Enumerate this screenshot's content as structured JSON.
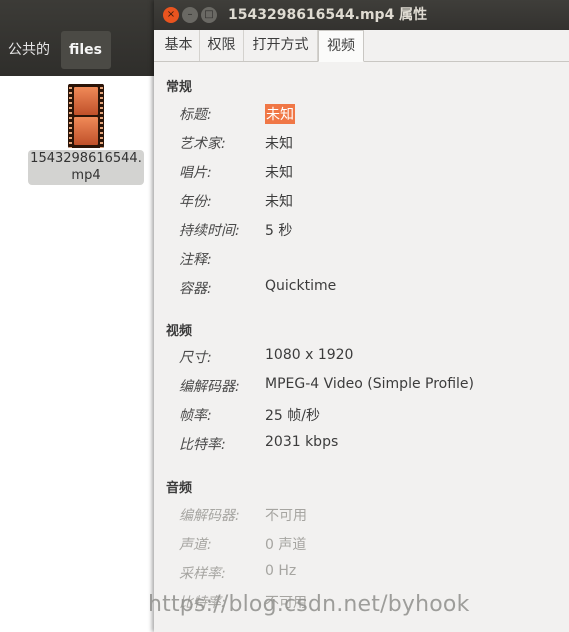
{
  "file_manager": {
    "path_buttons": [
      "公共的",
      "files"
    ],
    "file": {
      "name_line1": "1543298616544.",
      "name_line2": "mp4"
    }
  },
  "dialog": {
    "title": "1543298616544.mp4 属性",
    "window_buttons": {
      "close": "×",
      "minimize": "–",
      "maximize": "□"
    },
    "tabs": [
      "基本",
      "权限",
      "打开方式",
      "视频"
    ],
    "active_tab": "视频",
    "sections": {
      "general": {
        "header": "常规",
        "rows": [
          {
            "label": "标题:",
            "value": "未知"
          },
          {
            "label": "艺术家:",
            "value": "未知"
          },
          {
            "label": "唱片:",
            "value": "未知"
          },
          {
            "label": "年份:",
            "value": "未知"
          },
          {
            "label": "持续时间:",
            "value": "5 秒"
          },
          {
            "label": "注释:",
            "value": ""
          },
          {
            "label": "容器:",
            "value": "Quicktime"
          }
        ]
      },
      "video": {
        "header": "视频",
        "rows": [
          {
            "label": "尺寸:",
            "value": "1080 x 1920"
          },
          {
            "label": "编解码器:",
            "value": "MPEG-4 Video (Simple Profile)"
          },
          {
            "label": "帧率:",
            "value": "25 帧/秒"
          },
          {
            "label": "比特率:",
            "value": "2031 kbps"
          }
        ]
      },
      "audio": {
        "header": "音频",
        "rows": [
          {
            "label": "编解码器:",
            "value": "不可用"
          },
          {
            "label": "声道:",
            "value": "0 声道"
          },
          {
            "label": "采样率:",
            "value": "0 Hz"
          },
          {
            "label": "比特率:",
            "value": "不可用"
          }
        ]
      }
    }
  },
  "watermark": "https://blog.csdn.net/byhook",
  "colors": {
    "accent": "#f07746",
    "titlebar": "#3c3b37",
    "close_button": "#e9541f"
  }
}
